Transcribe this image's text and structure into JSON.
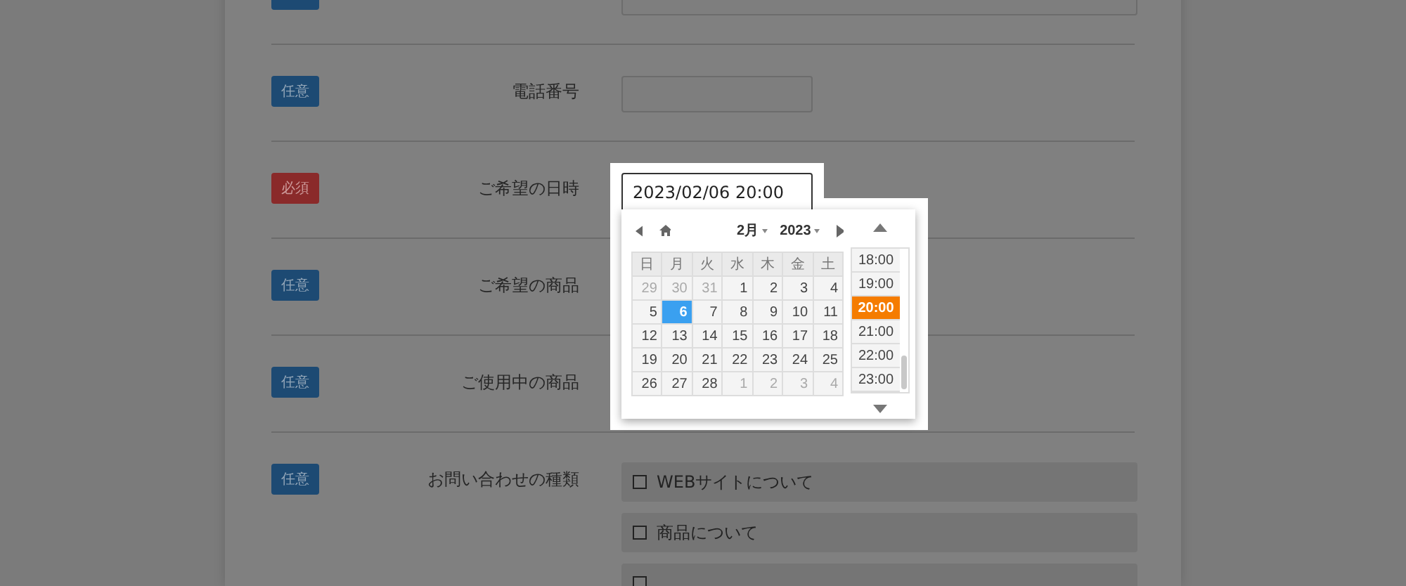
{
  "form": {
    "rows": [
      {
        "kind": "cut",
        "badge": {
          "required": false
        }
      },
      {
        "kind": "text",
        "badge": {
          "label": "任意",
          "required": false
        },
        "label": "電話番号",
        "value": ""
      },
      {
        "kind": "date",
        "badge": {
          "label": "必須",
          "required": true
        },
        "label": "ご希望の日時",
        "value": "2023/02/06 20:00"
      },
      {
        "kind": "empty",
        "badge": {
          "label": "任意",
          "required": false
        },
        "label": "ご希望の商品"
      },
      {
        "kind": "empty",
        "badge": {
          "label": "任意",
          "required": false
        },
        "label": "ご使用中の商品"
      },
      {
        "kind": "checkboxes",
        "badge": {
          "label": "任意",
          "required": false
        },
        "label": "お問い合わせの種類",
        "options": [
          {
            "label": "WEBサイトについて",
            "checked": false
          },
          {
            "label": "商品について",
            "checked": false
          },
          {
            "checked": false
          }
        ]
      }
    ]
  },
  "datepicker": {
    "month": "2月",
    "year": "2023",
    "weekdays": [
      "日",
      "月",
      "火",
      "水",
      "木",
      "金",
      "土"
    ],
    "weeks": [
      [
        {
          "day": "29",
          "muted": true,
          "selected": false
        },
        {
          "day": "30",
          "muted": true,
          "selected": false
        },
        {
          "day": "31",
          "muted": true,
          "selected": false
        },
        {
          "day": "1",
          "muted": false,
          "selected": false
        },
        {
          "day": "2",
          "muted": false,
          "selected": false
        },
        {
          "day": "3",
          "muted": false,
          "selected": false
        },
        {
          "day": "4",
          "muted": false,
          "selected": false
        }
      ],
      [
        {
          "day": "5",
          "muted": false,
          "selected": false
        },
        {
          "day": "6",
          "muted": false,
          "selected": true
        },
        {
          "day": "7",
          "muted": false,
          "selected": false
        },
        {
          "day": "8",
          "muted": false,
          "selected": false
        },
        {
          "day": "9",
          "muted": false,
          "selected": false
        },
        {
          "day": "10",
          "muted": false,
          "selected": false
        },
        {
          "day": "11",
          "muted": false,
          "selected": false
        }
      ],
      [
        {
          "day": "12",
          "muted": false,
          "selected": false
        },
        {
          "day": "13",
          "muted": false,
          "selected": false
        },
        {
          "day": "14",
          "muted": false,
          "selected": false
        },
        {
          "day": "15",
          "muted": false,
          "selected": false
        },
        {
          "day": "16",
          "muted": false,
          "selected": false
        },
        {
          "day": "17",
          "muted": false,
          "selected": false
        },
        {
          "day": "18",
          "muted": false,
          "selected": false
        }
      ],
      [
        {
          "day": "19",
          "muted": false,
          "selected": false
        },
        {
          "day": "20",
          "muted": false,
          "selected": false
        },
        {
          "day": "21",
          "muted": false,
          "selected": false
        },
        {
          "day": "22",
          "muted": false,
          "selected": false
        },
        {
          "day": "23",
          "muted": false,
          "selected": false
        },
        {
          "day": "24",
          "muted": false,
          "selected": false
        },
        {
          "day": "25",
          "muted": false,
          "selected": false
        }
      ],
      [
        {
          "day": "26",
          "muted": false,
          "selected": false
        },
        {
          "day": "27",
          "muted": false,
          "selected": false
        },
        {
          "day": "28",
          "muted": false,
          "selected": false
        },
        {
          "day": "1",
          "muted": true,
          "selected": false
        },
        {
          "day": "2",
          "muted": true,
          "selected": false
        },
        {
          "day": "3",
          "muted": true,
          "selected": false
        },
        {
          "day": "4",
          "muted": true,
          "selected": false
        }
      ]
    ],
    "times": [
      {
        "label": "18:00",
        "selected": false
      },
      {
        "label": "19:00",
        "selected": false
      },
      {
        "label": "20:00",
        "selected": true
      },
      {
        "label": "21:00",
        "selected": false
      },
      {
        "label": "22:00",
        "selected": false
      },
      {
        "label": "23:00",
        "selected": false
      }
    ]
  }
}
